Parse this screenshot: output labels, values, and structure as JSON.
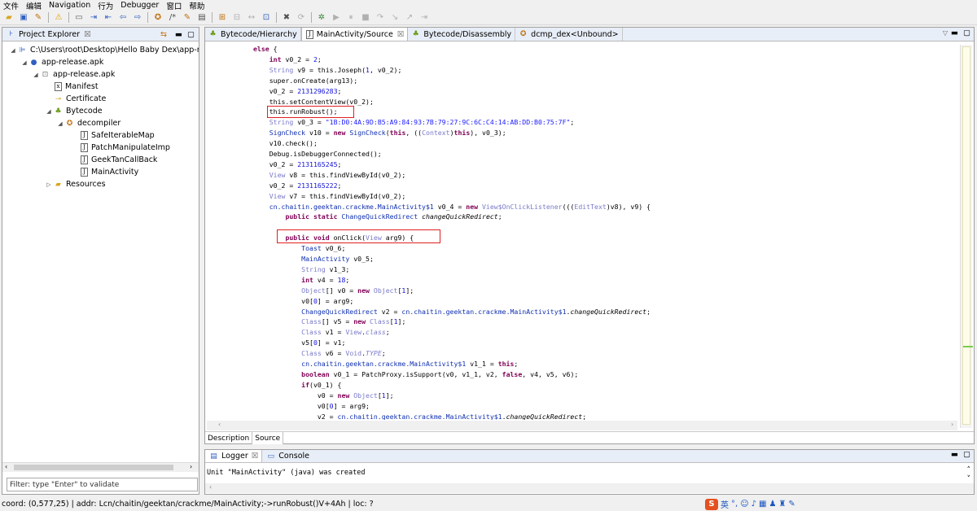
{
  "menu": [
    "文件",
    "编辑",
    "Navigation",
    "行为",
    "Debugger",
    "窗口",
    "帮助"
  ],
  "left_panel": {
    "title": "Project Explorer",
    "close_glyph": "☒",
    "tree": [
      {
        "label": "C:\\Users\\root\\Desktop\\Hello Baby Dex\\app-re",
        "icon": "folder-path-icon",
        "twisty": "◢"
      },
      {
        "label": "app-release.apk",
        "icon": "apk-icon",
        "twisty": "◢"
      },
      {
        "label": "app-release.apk",
        "icon": "apk-package-icon",
        "twisty": "◢"
      },
      {
        "label": "Manifest",
        "icon": "xml-file-icon",
        "twisty": ""
      },
      {
        "label": "Certificate",
        "icon": "certificate-icon",
        "twisty": ""
      },
      {
        "label": "Bytecode",
        "icon": "android-icon",
        "twisty": "◢"
      },
      {
        "label": "decompiler",
        "icon": "package-icon",
        "twisty": "◢"
      },
      {
        "label": "SafeIterableMap",
        "icon": "java-file-icon",
        "twisty": ""
      },
      {
        "label": "PatchManipulateImp",
        "icon": "java-file-icon",
        "twisty": ""
      },
      {
        "label": "GeekTanCallBack",
        "icon": "java-file-icon",
        "twisty": ""
      },
      {
        "label": "MainActivity",
        "icon": "java-file-icon",
        "twisty": ""
      },
      {
        "label": "Resources",
        "icon": "folder-icon",
        "twisty": "▷"
      }
    ],
    "filter_placeholder": "Filter: type \"Enter\" to validate"
  },
  "editor": {
    "tabs": [
      {
        "label": "Bytecode/Hierarchy",
        "icon": "android-icon",
        "active": false
      },
      {
        "label": "MainActivity/Source",
        "icon": "java-file-icon",
        "active": true
      },
      {
        "label": "Bytecode/Disassembly",
        "icon": "android-icon",
        "active": false
      },
      {
        "label": "dcmp_dex<Unbound>",
        "icon": "package-icon",
        "active": false
      }
    ],
    "active_close": "☒",
    "bottom_tabs": [
      "Description",
      "Source"
    ],
    "code_lines": [
      "else {",
      "    int v0_2 = 2;",
      "    String v9 = this.Joseph(1, v0_2);",
      "    super.onCreate(arg13);",
      "    v0_2 = 2131296283;",
      "    this.setContentView(v0_2);",
      "    this.runRobust();",
      "    String v0_3 = \"1B:D0:4A:9D:B5:A9:84:93:7B:79:27:9C:6C:C4:14:AB:DD:B0:75:7F\";",
      "    SignCheck v10 = new SignCheck(this, ((Context)this), v0_3);",
      "    v10.check();",
      "    Debug.isDebuggerConnected();",
      "    v0_2 = 2131165245;",
      "    View v8 = this.findViewById(v0_2);",
      "    v0_2 = 2131165222;",
      "    View v7 = this.findViewById(v0_2);",
      "    cn.chaitin.geektan.crackme.MainActivity$1 v0_4 = new View$OnClickListener(((EditText)v8), v9) {",
      "        public static ChangeQuickRedirect changeQuickRedirect;",
      "",
      "        public void onClick(View arg9) {",
      "            Toast v0_6;",
      "            MainActivity v0_5;",
      "            String v1_3;",
      "            int v4 = 18;",
      "            Object[] v0 = new Object[1];",
      "            v0[0] = arg9;",
      "            ChangeQuickRedirect v2 = cn.chaitin.geektan.crackme.MainActivity$1.changeQuickRedirect;",
      "            Class[] v5 = new Class[1];",
      "            Class v1 = View.class;",
      "            v5[0] = v1;",
      "            Class v6 = Void.TYPE;",
      "            cn.chaitin.geektan.crackme.MainActivity$1 v1_1 = this;",
      "            boolean v0_1 = PatchProxy.isSupport(v0, v1_1, v2, false, v4, v5, v6);",
      "            if(v0_1) {",
      "                v0 = new Object[1];",
      "                v0[0] = arg9;",
      "                v2 = cn.chaitin.geektan.crackme.MainActivity$1.changeQuickRedirect;"
    ]
  },
  "bottom_panel": {
    "tabs": [
      "Logger",
      "Console"
    ],
    "log_line": "Unit \"MainActivity\" (java) was created"
  },
  "status": {
    "text": "coord: (0,577,25) | addr: Lcn/chaitin/geektan/crackme/MainActivity;->runRobust()V+4Ah | loc: ?",
    "ime_label": "英"
  },
  "colors": {
    "highlight_box": "#e02020",
    "keyword": "#7f0055",
    "number": "#1010d8"
  }
}
